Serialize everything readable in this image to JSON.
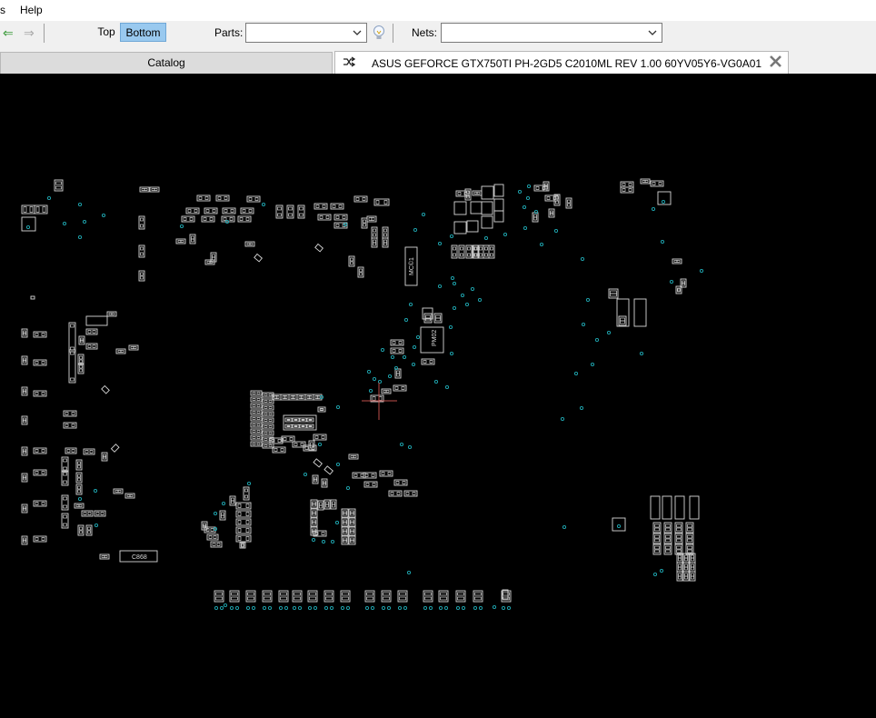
{
  "menu": {
    "partial_item": "s",
    "help": "Help"
  },
  "toolbar": {
    "back_icon": "arrow-left-icon",
    "forward_icon": "arrow-right-icon",
    "top_label": "Top",
    "bottom_label": "Bottom",
    "active_side": "Bottom",
    "parts_label": "Parts:",
    "parts_value": "",
    "bulb_icon": "lightbulb-icon",
    "nets_label": "Nets:",
    "nets_value": ""
  },
  "tabs": {
    "catalog": "Catalog",
    "board_title": "ASUS GEFORCE GTX750TI PH-2GD5 C2010ML REV 1.00 60YV05Y6-VG0A01"
  },
  "board": {
    "labels": {
      "chip_a": "MC©1",
      "chip_b": "PM02",
      "part_c868": "C868"
    },
    "colors": {
      "outline": "#d8d8d8",
      "via": "#1fa9b3",
      "cursor": "#c0504d",
      "active_button": "#99c9ef"
    }
  }
}
